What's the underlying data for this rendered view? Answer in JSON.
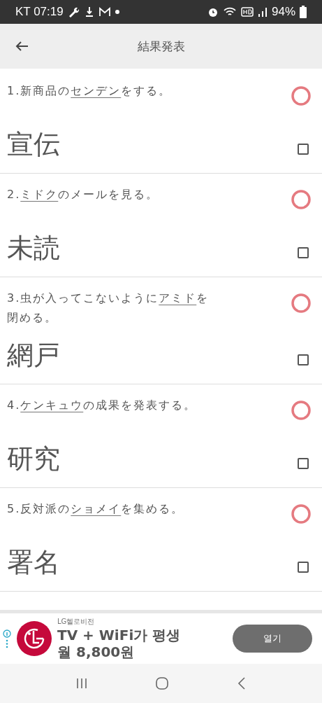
{
  "status_bar": {
    "carrier_time": "KT 07:19",
    "battery": "94%"
  },
  "header": {
    "title": "結果発表"
  },
  "questions": [
    {
      "number": "1.",
      "before": "新商品の",
      "target": "センデン",
      "after": "をする。",
      "answer": "宣伝",
      "correct": true,
      "checked": false
    },
    {
      "number": "2.",
      "target": "ミドク",
      "after": "のメールを見る。",
      "answer": "未読",
      "correct": true,
      "checked": false
    },
    {
      "number": "3.",
      "before": "虫が入ってこないように",
      "target": "アミド",
      "after": "を閉める。",
      "answer": "網戸",
      "correct": true,
      "checked": false
    },
    {
      "number": "4.",
      "target": "ケンキュウ",
      "after": "の成果を発表する。",
      "answer": "研究",
      "correct": true,
      "checked": false
    },
    {
      "number": "5.",
      "before": "反対派の",
      "target": "ショメイ",
      "after": "を集める。",
      "answer": "署名",
      "correct": true,
      "checked": false
    }
  ],
  "ad": {
    "advertiser": "LG헬로비전",
    "headline": "TV + WiFi가 평생 월 8,800원",
    "button": "열기"
  }
}
